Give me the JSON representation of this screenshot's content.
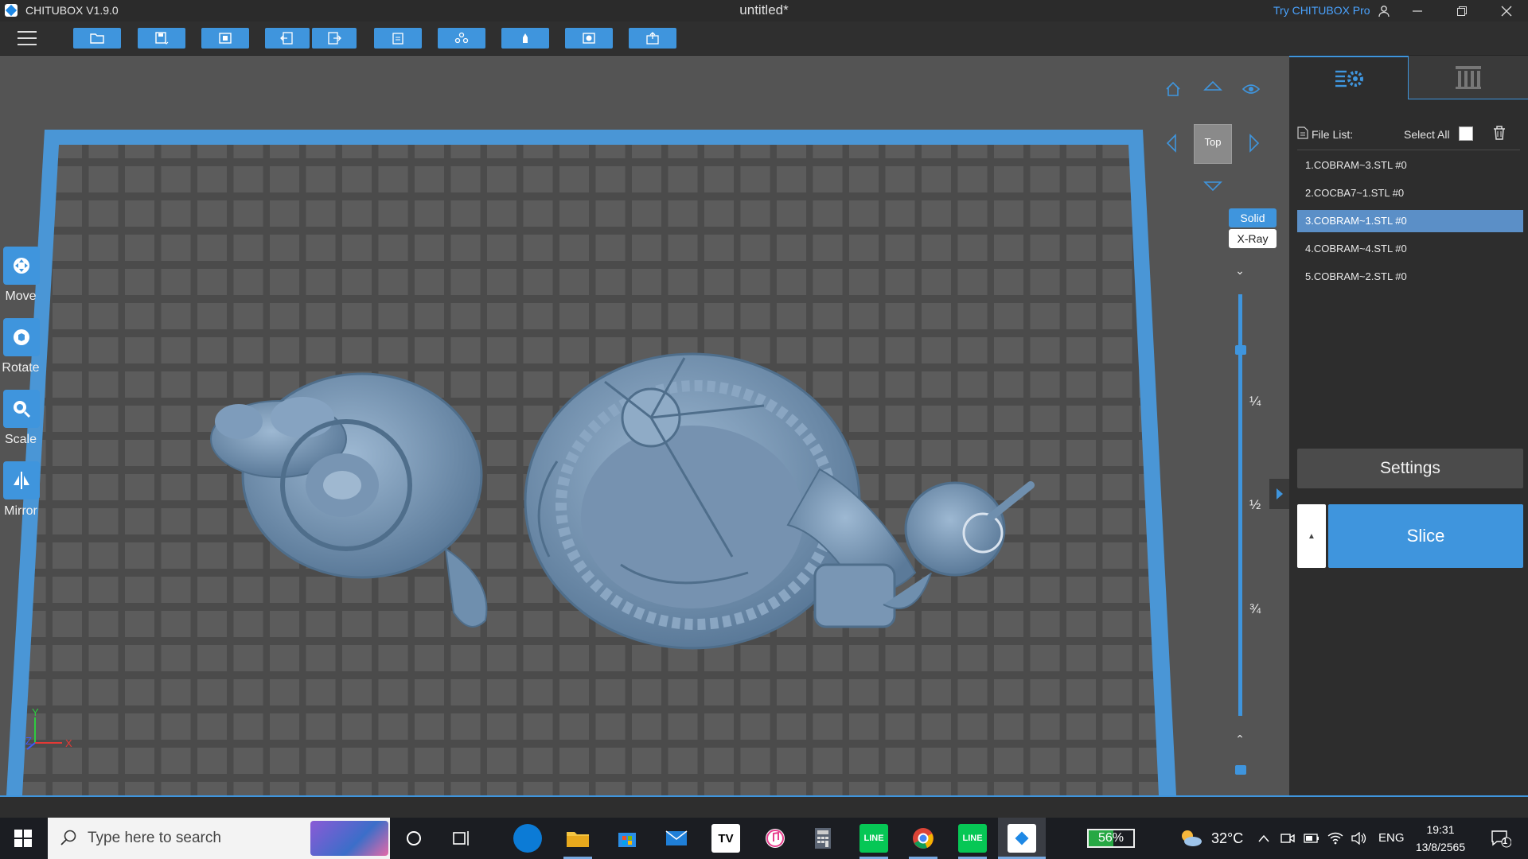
{
  "window": {
    "app_name": "CHITUBOX V1.9.0",
    "document_title": "untitled*",
    "pro_link": "Try CHITUBOX Pro"
  },
  "toolbar": {
    "icons": [
      "open-file-icon",
      "save-icon",
      "screenshot-icon",
      "undo-icon",
      "redo-icon",
      "clipboard-icon",
      "arrange-icon",
      "support-icon",
      "hollow-icon",
      "export-icon"
    ]
  },
  "tools": {
    "move": "Move",
    "rotate": "Rotate",
    "scale": "Scale",
    "mirror": "Mirror"
  },
  "view": {
    "current_view": "Top",
    "mode_solid": "Solid",
    "mode_xray": "X-Ray",
    "active_mode": "Solid"
  },
  "layer_slider": {
    "marks": [
      "¼",
      "½",
      "¾"
    ]
  },
  "axes": {
    "x": "X",
    "y": "Y",
    "z": "Z"
  },
  "panel": {
    "file_list_label": "File List:",
    "select_all_label": "Select All",
    "files": [
      {
        "name": "1.COBRAM~3.STL #0",
        "selected": false
      },
      {
        "name": "2.COCBA7~1.STL #0",
        "selected": false
      },
      {
        "name": "3.COBRAM~1.STL #0",
        "selected": true
      },
      {
        "name": "4.COBRAM~4.STL #0",
        "selected": false
      },
      {
        "name": "5.COBRAM~2.STL #0",
        "selected": false
      }
    ],
    "settings_label": "Settings",
    "slice_label": "Slice"
  },
  "taskbar": {
    "search_placeholder": "Type here to search",
    "battery": "56%",
    "temperature": "32°C",
    "language": "ENG",
    "time": "19:31",
    "date": "13/8/2565",
    "notifications": "1"
  },
  "colors": {
    "accent": "#3f95dd",
    "viewport_bg": "#545454",
    "plate_border": "#4a96d6",
    "model": "#6f8fae"
  }
}
